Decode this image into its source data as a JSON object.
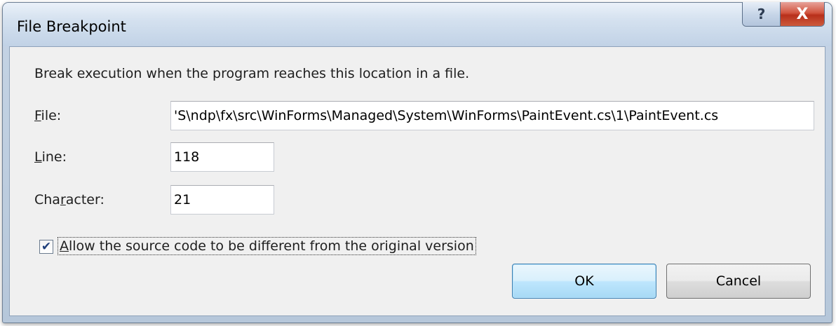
{
  "window": {
    "title": "File Breakpoint",
    "help_glyph": "?",
    "close_glyph": "X"
  },
  "dialog": {
    "description": "Break execution when the program reaches this location in a file.",
    "file": {
      "label_accel": "F",
      "label_rest": "ile:",
      "value": "'S\\ndp\\fx\\src\\WinForms\\Managed\\System\\WinForms\\PaintEvent.cs\\1\\PaintEvent.cs"
    },
    "line": {
      "label_accel": "L",
      "label_rest": "ine:",
      "value": "118"
    },
    "character": {
      "label_pre": "Cha",
      "label_accel": "r",
      "label_rest": "acter:",
      "value": "21"
    },
    "allow_diff": {
      "checked": true,
      "check_glyph": "✔",
      "label_accel": "A",
      "label_rest": "llow the source code to be different from the original version"
    }
  },
  "buttons": {
    "ok": "OK",
    "cancel": "Cancel"
  }
}
